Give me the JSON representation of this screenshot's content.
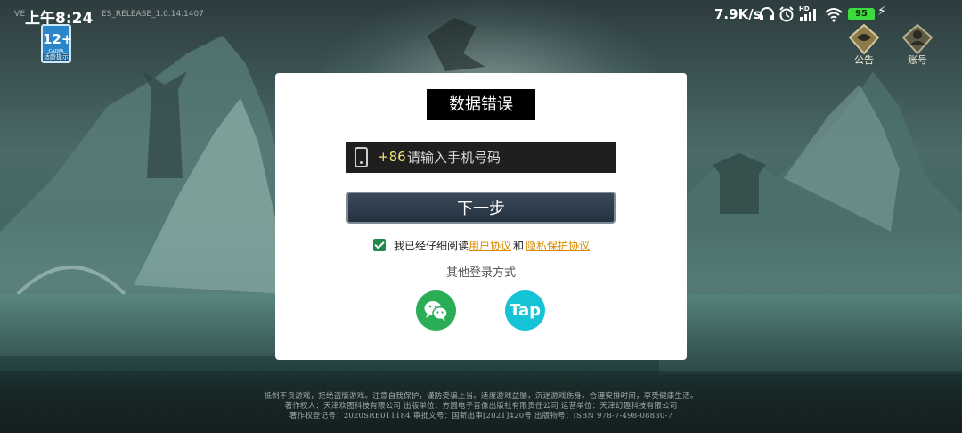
{
  "status_bar": {
    "time": "上午8:24",
    "version_prefix": "VE",
    "version_suffix": "ES_RELEASE_1.0.14.1407",
    "net_speed": "7.9K/s",
    "signal_tag": "HD",
    "battery": "95"
  },
  "age_rating": {
    "number": "12+",
    "org": "CADPA",
    "tip": "适龄提示"
  },
  "corner_buttons": [
    {
      "label": "公告",
      "icon": "notice-icon"
    },
    {
      "label": "账号",
      "icon": "account-icon"
    }
  ],
  "dialog": {
    "title": "数据错误",
    "country_code": "+86",
    "phone_placeholder": "请输入手机号码",
    "next_button": "下一步",
    "agree_prefix": "我已经仔细阅读",
    "user_agreement": "用户协议",
    "agree_and": "和",
    "privacy_agreement": "隐私保护协议",
    "agree_checked": true,
    "other_login_title": "其他登录方式",
    "other_logins": [
      {
        "name": "wechat",
        "icon": "wechat-icon"
      },
      {
        "name": "taptap",
        "label": "Tap",
        "icon": "taptap-icon"
      }
    ]
  },
  "footer": [
    "抵制不良游戏，拒绝盗版游戏。注意自我保护，谨防受骗上当。适度游戏益脑，沉迷游戏伤身。合理安排时间，享受健康生活。",
    "著作权人：天津欢图科技有限公司  出版单位：方圆电子音像出版社有限责任公司  运营单位：天津幻趣科技有限公司",
    "著作权登记号：2020SRE011184 审批文号：国新出审[2021]420号 出版物号：ISBN 978-7-498-08830-7"
  ],
  "colors": {
    "dialog_bg": "#ffffff",
    "title_bg": "#000000",
    "input_bg": "#1f1f1f",
    "country_code": "#f0e07a",
    "button_bg": "#2e3d4c",
    "link": "#d98a00",
    "wechat": "#2bad55",
    "taptap": "#15c3d6"
  }
}
